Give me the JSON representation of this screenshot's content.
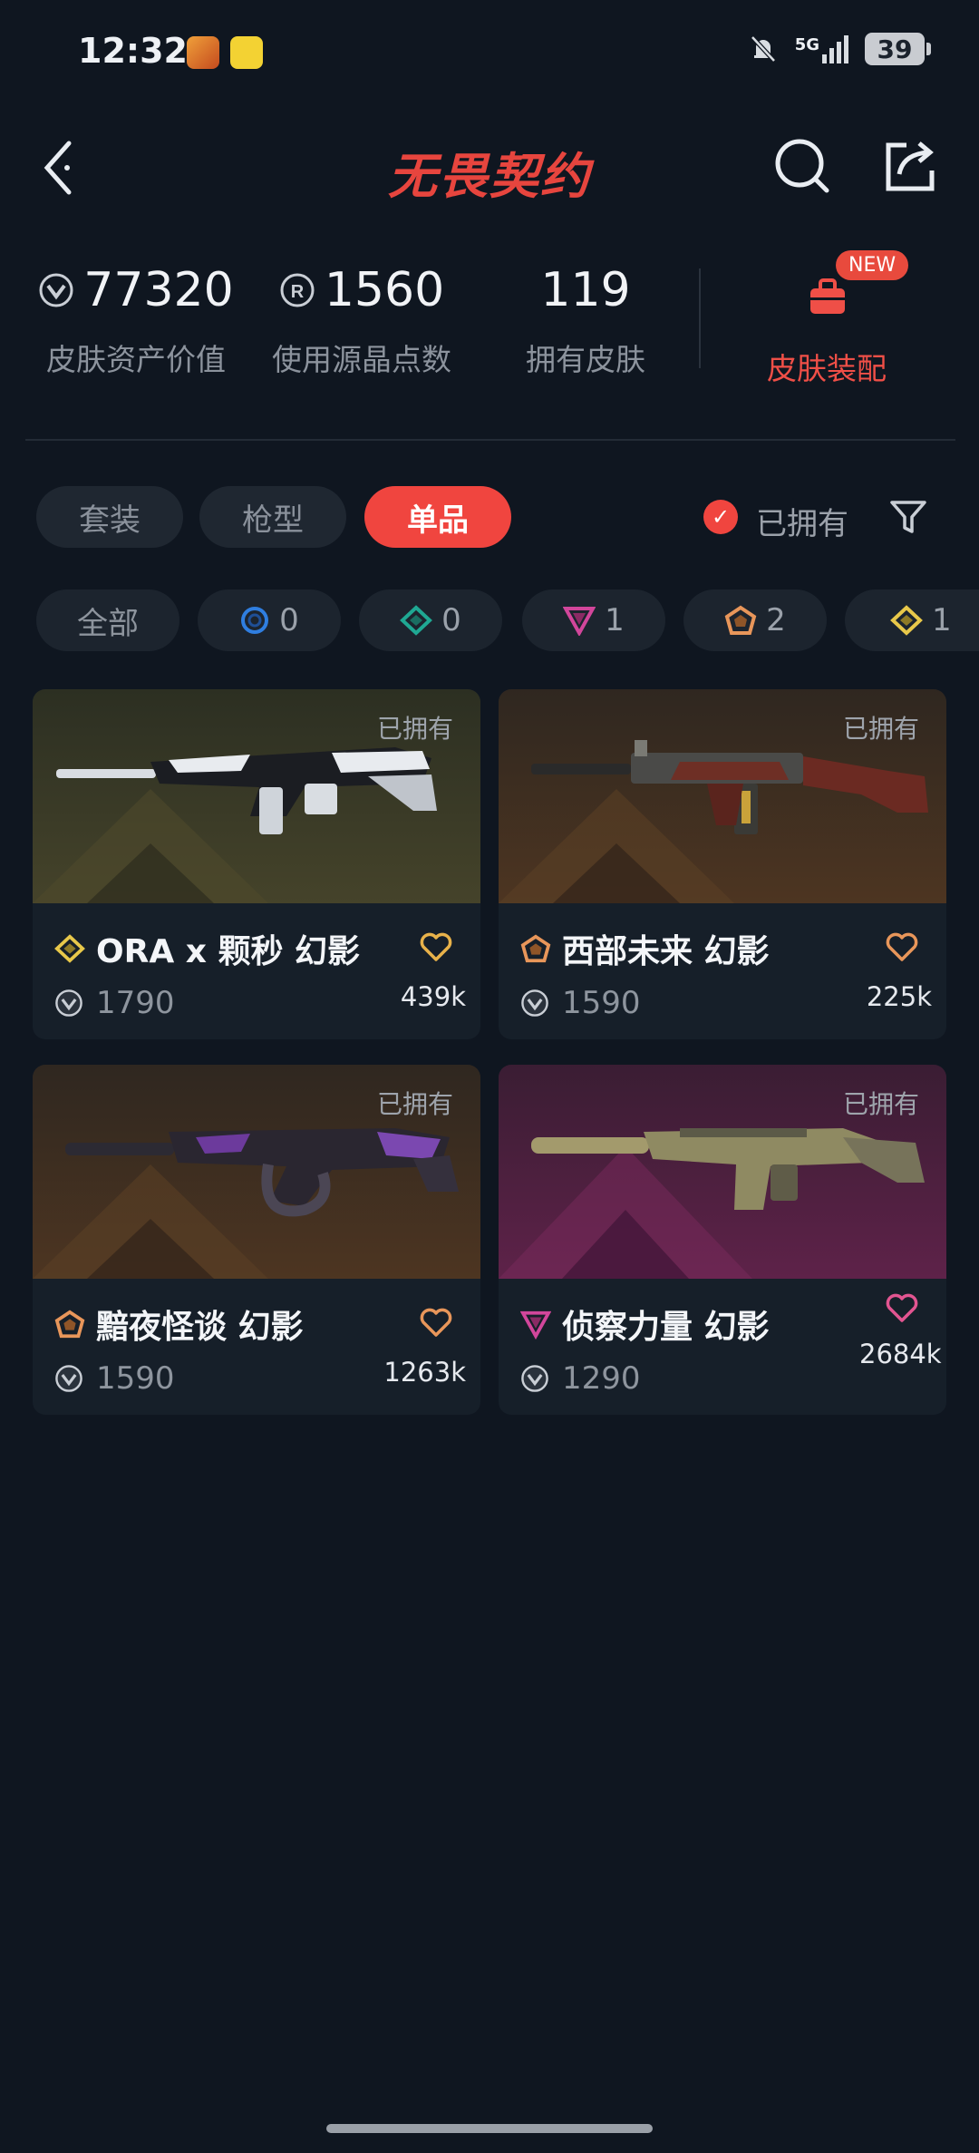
{
  "status": {
    "time": "12:32",
    "battery": "39",
    "network": "5G"
  },
  "header": {
    "logo_text": "无畏契约"
  },
  "stats": [
    {
      "value": "77320",
      "label": "皮肤资产价值",
      "icon": "vp-icon"
    },
    {
      "value": "1560",
      "label": "使用源晶点数",
      "icon": "radianite-icon"
    },
    {
      "value": "119",
      "label": "拥有皮肤",
      "icon": ""
    }
  ],
  "equip": {
    "label": "皮肤装配",
    "badge": "NEW"
  },
  "tabs": [
    {
      "label": "套装",
      "active": false
    },
    {
      "label": "枪型",
      "active": false
    },
    {
      "label": "单品",
      "active": true
    }
  ],
  "owned_filter": {
    "label": "已拥有",
    "checked": true
  },
  "tiers": [
    {
      "label": "全部"
    },
    {
      "count": "0",
      "icon": "select-tier-icon",
      "color": "#2f7ee0"
    },
    {
      "count": "0",
      "icon": "deluxe-tier-icon",
      "color": "#1fa893"
    },
    {
      "count": "1",
      "icon": "premium-tier-icon",
      "color": "#d2469b"
    },
    {
      "count": "2",
      "icon": "exclusive-tier-icon",
      "color": "#e8965a"
    },
    {
      "count": "1",
      "icon": "ultra-tier-icon",
      "color": "#e8c84a"
    }
  ],
  "cards": [
    {
      "name": "ORA x 颗秒 幻影",
      "price": "1790",
      "likes": "439k",
      "owned": "已拥有",
      "tier_color": "#e8c84a",
      "heart_color": "#e8b24a",
      "bg": "#3b3a22"
    },
    {
      "name": "西部未来 幻影",
      "price": "1590",
      "likes": "225k",
      "owned": "已拥有",
      "tier_color": "#e8965a",
      "heart_color": "#e8965a",
      "bg": "#4b3522"
    },
    {
      "name": "黯夜怪谈 幻影",
      "price": "1590",
      "likes": "1263k",
      "owned": "已拥有",
      "tier_color": "#e8965a",
      "heart_color": "#e8965a",
      "bg": "#4b3522"
    },
    {
      "name": "侦察力量 幻影",
      "price": "1290",
      "likes": "2684k",
      "owned": "已拥有",
      "tier_color": "#d2469b",
      "heart_color": "#e25591",
      "bg": "#5b2148"
    }
  ]
}
